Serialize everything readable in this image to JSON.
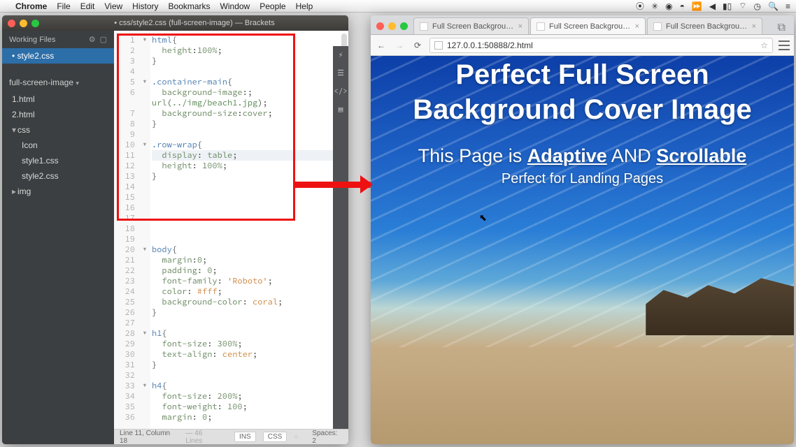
{
  "menubar": {
    "app": "Chrome",
    "items": [
      "File",
      "Edit",
      "View",
      "History",
      "Bookmarks",
      "Window",
      "People",
      "Help"
    ]
  },
  "brackets": {
    "title": "• css/style2.css (full-screen-image) — Brackets",
    "workingFilesLabel": "Working Files",
    "workingFiles": [
      "style2.css"
    ],
    "projectName": "full-screen-image",
    "tree": [
      {
        "label": "1.html",
        "indent": 0
      },
      {
        "label": "2.html",
        "indent": 0
      },
      {
        "label": "css",
        "indent": 0,
        "folder": true,
        "open": true
      },
      {
        "label": "Icon",
        "indent": 1
      },
      {
        "label": "style1.css",
        "indent": 1
      },
      {
        "label": "style2.css",
        "indent": 1
      },
      {
        "label": "img",
        "indent": 0,
        "folder": true,
        "open": false
      }
    ],
    "code": [
      {
        "n": 1,
        "f": "▼",
        "t": "html{",
        "cls": "sel"
      },
      {
        "n": 2,
        "t": "  height:100%;",
        "cls": "prop"
      },
      {
        "n": 3,
        "t": "}",
        "cls": "punc"
      },
      {
        "n": 4,
        "t": ""
      },
      {
        "n": 5,
        "f": "▼",
        "t": ".container-main{",
        "cls": "sel"
      },
      {
        "n": 6,
        "t": "  background-image:",
        "cls": "prop"
      },
      {
        "n": null,
        "t": "url(../img/beach1.jpg);",
        "cls": "url"
      },
      {
        "n": 7,
        "t": "  background-size:cover;",
        "cls": "prop"
      },
      {
        "n": 8,
        "t": "}",
        "cls": "punc"
      },
      {
        "n": 9,
        "t": ""
      },
      {
        "n": 10,
        "f": "▼",
        "t": ".row-wrap{",
        "cls": "sel"
      },
      {
        "n": 11,
        "t": "  display: table;",
        "cls": "prop",
        "active": true
      },
      {
        "n": 12,
        "t": "  height: 100%;",
        "cls": "prop"
      },
      {
        "n": 13,
        "t": "}",
        "cls": "punc"
      },
      {
        "n": 14,
        "t": ""
      },
      {
        "n": 15,
        "t": ""
      },
      {
        "n": 16,
        "t": ""
      },
      {
        "n": 17,
        "t": ""
      },
      {
        "n": 18,
        "t": ""
      },
      {
        "n": 19,
        "t": ""
      },
      {
        "n": 20,
        "f": "▼",
        "t": "body{",
        "cls": "sel"
      },
      {
        "n": 21,
        "t": "  margin:0;",
        "cls": "prop"
      },
      {
        "n": 22,
        "t": "  padding: 0;",
        "cls": "prop"
      },
      {
        "n": 23,
        "t": "  font-family: 'Roboto';",
        "cls": "propstr"
      },
      {
        "n": 24,
        "t": "  color: #fff;",
        "cls": "propstr"
      },
      {
        "n": 25,
        "t": "  background-color: coral;",
        "cls": "propstr"
      },
      {
        "n": 26,
        "t": "}",
        "cls": "punc"
      },
      {
        "n": 27,
        "t": ""
      },
      {
        "n": 28,
        "f": "▼",
        "t": "h1{",
        "cls": "sel"
      },
      {
        "n": 29,
        "t": "  font-size: 300%;",
        "cls": "prop"
      },
      {
        "n": 30,
        "t": "  text-align: center",
        "cls": "propstr"
      },
      {
        "n": 31,
        "t": "}",
        "cls": "punc"
      },
      {
        "n": 32,
        "t": ""
      },
      {
        "n": 33,
        "f": "▼",
        "t": "h4{",
        "cls": "sel"
      },
      {
        "n": 34,
        "t": "  font-size: 200%;",
        "cls": "prop"
      },
      {
        "n": 35,
        "t": "  font-weight: 100;",
        "cls": "prop"
      },
      {
        "n": 36,
        "t": "  margin: 0;",
        "cls": "prop"
      }
    ],
    "status": {
      "pos": "Line 11, Column 18",
      "lines": "— 46 Lines",
      "ins": "INS",
      "lang": "CSS",
      "spaces": "Spaces: 2"
    }
  },
  "chrome": {
    "tabs": [
      {
        "label": "Full Screen Background",
        "active": false
      },
      {
        "label": "Full Screen Background",
        "active": true
      },
      {
        "label": "Full Screen Background",
        "active": false
      }
    ],
    "url": "127.0.0.1:50888/2.html",
    "page": {
      "h1": "Perfect Full Screen Background Cover Image",
      "h2_pre": "This Page is ",
      "h2_u1": "Adaptive",
      "h2_mid": " AND ",
      "h2_u2": "Scrollable",
      "h3": "Perfect for Landing Pages"
    }
  }
}
